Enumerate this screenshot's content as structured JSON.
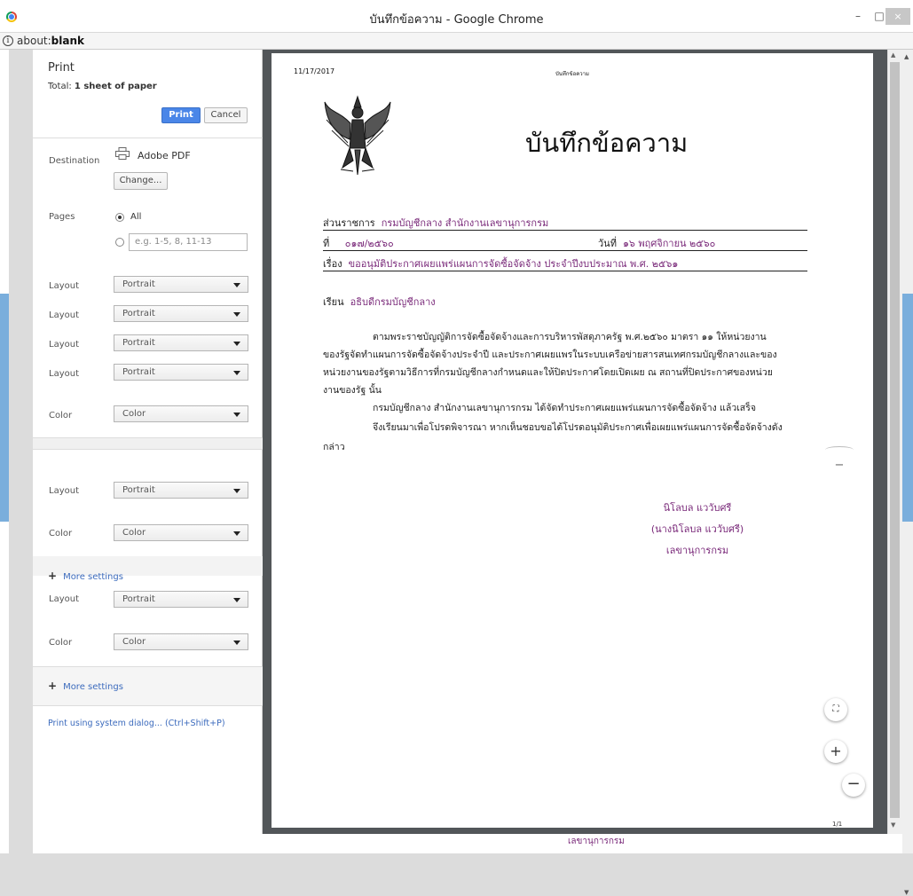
{
  "window": {
    "title": "บันทึกข้อความ - Google Chrome",
    "minimize": "–",
    "maximize": "□",
    "close": "×"
  },
  "address": {
    "scheme": "about:",
    "host": "blank",
    "info_icon": "i"
  },
  "print": {
    "heading": "Print",
    "total_prefix": "Total: ",
    "total_value": "1 sheet of paper",
    "print_label": "Print",
    "cancel_label": "Cancel",
    "destination_label": "Destination",
    "destination_name": "Adobe PDF",
    "change_label": "Change...",
    "pages_label": "Pages",
    "pages_all": "All",
    "pages_placeholder": "e.g. 1-5, 8, 11-13",
    "layout_label": "Layout",
    "color_label": "Color",
    "portrait": "Portrait",
    "color_value": "Color",
    "more_settings": "More settings",
    "plus": "+",
    "system_dialog": "Print using system dialog... (Ctrl+Shift+P)"
  },
  "document": {
    "header_date": "11/17/2017",
    "header_title": "บันทึกข้อความ",
    "title": "บันทึกข้อความ",
    "agency_label": "ส่วนราชการ",
    "agency_value": "กรมบัญชีกลาง สำนักงานเลขานุการกรม",
    "no_label": "ที่",
    "no_value": "๐๑๗/๒๕๖๐",
    "date_label": "วันที่",
    "date_value": "๑๖ พฤศจิกายน ๒๕๖๐",
    "subject_label": "เรื่อง",
    "subject_value": "ขออนุมัติประกาศเผยแพร่แผนการจัดซื้อจัดจ้าง ประจำปีงบประมาณ พ.ศ. ๒๕๖๑",
    "to_label": "เรียน",
    "to_value": "อธิบดีกรมบัญชีกลาง",
    "p1_l1": "ตามพระราชบัญญัติการจัดซื้อจัดจ้างและการบริหารพัสดุภาครัฐ พ.ศ.๒๕๖๐ มาตรา ๑๑ ให้หน่วยงาน",
    "p1_l2": "ของรัฐจัดทำแผนการจัดซื้อจัดจ้างประจำปี และประกาศเผยแพรในระบบเครือข่ายสารสนเทศกรมบัญชีกลางและของ",
    "p1_l3": "หน่วยงานของรัฐตามวิธีการที่กรมบัญชีกลางกำหนดและให้ปิดประกาศโดยเปิดเผย ณ สถานที่ปิดประกาศของหน่วย",
    "p1_l4": "งานของรัฐ นั้น",
    "p2": "กรมบัญชีกลาง สำนักงานเลขานุการกรม ได้จัดทำประกาศเผยแพร่แผนการจัดซื้อจัดจ้าง แล้วเสร็จ",
    "p3_l1": "จึงเรียนมาเพื่อโปรดพิจารณา หากเห็นชอบขอได้โปรดอนุมัติประกาศเพื่อเผยแพร่แผนการจัดซื้อจัดจ้างดัง",
    "p3_l2": "กล่าว",
    "sig_name": "นิโลบล แววับศรี",
    "sig_full": "(นางนิโลบล แววับศรี)",
    "sig_position": "เลขานุการกรม",
    "page_count": "1/1"
  },
  "viewer": {
    "fit": "⛶",
    "zoom_in": "+",
    "zoom_out": "−",
    "ghost": "−"
  },
  "bottom_text": "เลขานุการกรม",
  "colors": {
    "accent": "#4a86e8",
    "link": "#3c6bbd",
    "doc_value": "#7a2a7a"
  }
}
